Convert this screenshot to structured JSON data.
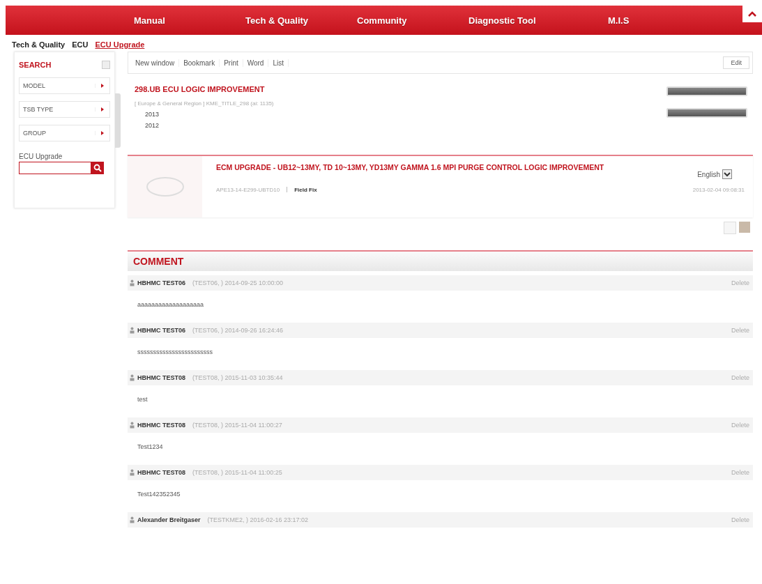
{
  "nav": {
    "items": [
      "Manual",
      "Tech & Quality",
      "Community",
      "Diagnostic Tool",
      "M.I.S"
    ]
  },
  "breadcrumb": [
    "Tech & Quality",
    "ECU",
    "ECU Upgrade"
  ],
  "sidebar": {
    "title": "SEARCH",
    "filters": [
      "MODEL",
      "TSB TYPE",
      "GROUP"
    ],
    "search_label": "ECU Upgrade"
  },
  "toolbar": {
    "items": [
      "New window",
      "Bookmark",
      "Print",
      "Word",
      "List"
    ],
    "edit": "Edit"
  },
  "tree": {
    "title": "298.UB ECU LOGIC IMPROVEMENT",
    "path": "[ Europe & General Region ] KME_TITLE_298 (ai: 1135)",
    "years": [
      "2013",
      "2012"
    ]
  },
  "article": {
    "title": "ECM UPGRADE - UB12~13MY, TD 10~13MY, YD13MY GAMMA 1.6 MPI PURGE CONTROL LOGIC IMPROVEMENT",
    "code": "APE13-14-E299-UBTD10",
    "type": "Field Fix",
    "language": "English",
    "date": "2013-02-04 09:08:31"
  },
  "comments": {
    "title": "COMMENT",
    "items": [
      {
        "author": "HBHMC TEST06",
        "meta": "(TEST06, ) 2014-09-25 10:00:00",
        "action": "Delete",
        "body": "aaaaaaaaaaaaaaaaaaa"
      },
      {
        "author": "HBHMC TEST06",
        "meta": "(TEST06, ) 2014-09-26 16:24:46",
        "action": "Delete",
        "body": "ssssssssssssssssssssssss"
      },
      {
        "author": "HBHMC TEST08",
        "meta": "(TEST08, ) 2015-11-03 10:35:44",
        "action": "Delete",
        "body": "test"
      },
      {
        "author": "HBHMC TEST08",
        "meta": "(TEST08, ) 2015-11-04 11:00:27",
        "action": "Delete",
        "body": "Test1234"
      },
      {
        "author": "HBHMC TEST08",
        "meta": "(TEST08, ) 2015-11-04 11:00:25",
        "action": "Delete",
        "body": "Test142352345"
      },
      {
        "author": "Alexander Breitgaser",
        "meta": "(TESTKME2, ) 2016-02-16 23:17:02",
        "action": "Delete"
      }
    ]
  }
}
